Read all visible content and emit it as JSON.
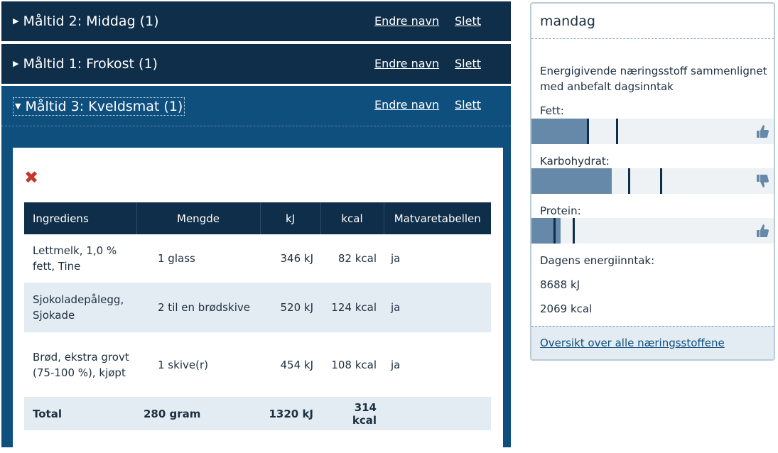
{
  "meals": [
    {
      "title": "Måltid 2: Middag (1)",
      "rename": "Endre navn",
      "delete": "Slett"
    },
    {
      "title": "Måltid 1: Frokost (1)",
      "rename": "Endre navn",
      "delete": "Slett"
    },
    {
      "title": "Måltid 3: Kveldsmat (1)",
      "rename": "Endre navn",
      "delete": "Slett"
    }
  ],
  "table": {
    "headers": [
      "Ingrediens",
      "Mengde",
      "kJ",
      "kcal",
      "Matvaretabellen"
    ],
    "rows": [
      {
        "name": "Lettmelk, 1,0 % fett, Tine",
        "amount": "1 glass",
        "kj": "346 kJ",
        "kcal": "82 kcal",
        "source": "ja"
      },
      {
        "name": "Sjokoladepålegg, Sjokade",
        "amount": "2 til en brødskive",
        "kj": "520 kJ",
        "kcal": "124 kcal",
        "source": "ja"
      },
      {
        "name": "Brød, ekstra grovt (75-100 %), kjøpt",
        "amount": "1 skive(r)",
        "kj": "454 kJ",
        "kcal": "108 kcal",
        "source": "ja"
      }
    ],
    "total": {
      "label": "Total",
      "amount": "280 gram",
      "kj": "1320 kJ",
      "kcal": "314 kcal"
    }
  },
  "summary": {
    "day": "mandag",
    "intro": "Energigivende næringsstoff sammenlignet med anbefalt dagsinntak",
    "nutrients": [
      {
        "label": "Fett:",
        "fill_fraction": 0.23,
        "markers": [
          0.23,
          0.35
        ],
        "icon": "thumbs-up-icon"
      },
      {
        "label": "Karbohydrat:",
        "fill_fraction": 0.33,
        "markers": [
          0.4,
          0.53
        ],
        "icon": "thumbs-down-icon"
      },
      {
        "label": "Protein:",
        "fill_fraction": 0.12,
        "markers": [
          0.09,
          0.17
        ],
        "icon": "thumbs-up-icon"
      }
    ],
    "energy_label": "Dagens energiinntak:",
    "energy_kj": "8688 kJ",
    "energy_kcal": "2069 kcal",
    "link": "Oversikt over alle næringsstoffene"
  },
  "colors": {
    "header": "#0f2e49",
    "active_meal": "#0e4f7e",
    "delete": "#c0392b",
    "fill": "#6789a9"
  }
}
